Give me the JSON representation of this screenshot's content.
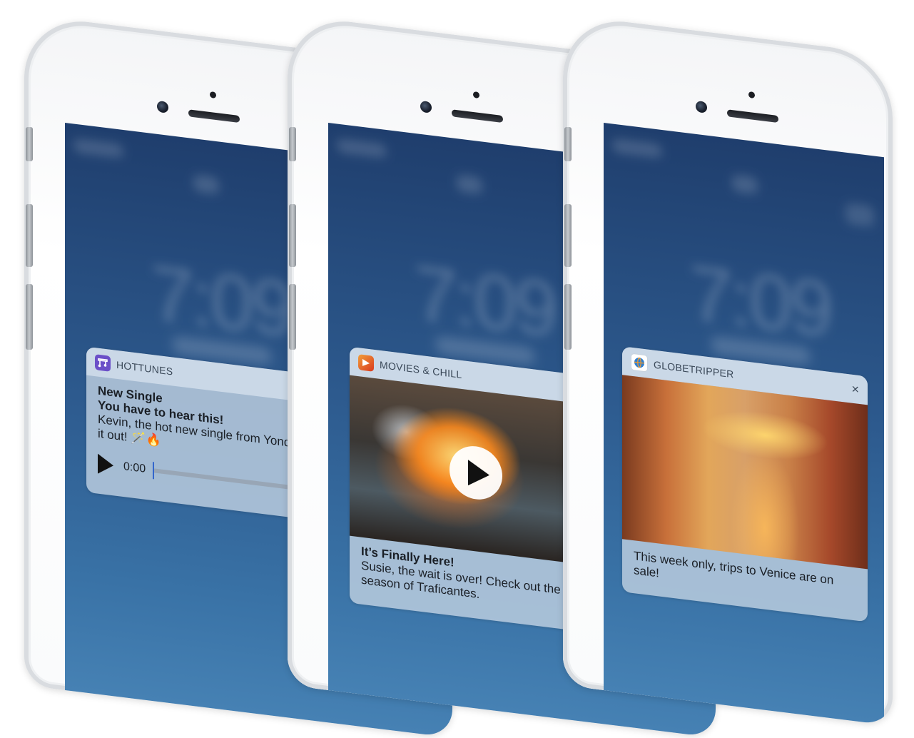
{
  "phones": [
    {
      "notification": {
        "app_name": "HOTTUNES",
        "icon": "music-note-icon",
        "icon_color": "#6b4fc8",
        "title": "New Single",
        "subtitle": "You have to hear this!",
        "message": "Kevin, the hot new single from YonderYo dropped. Check it out! 🪄🔥",
        "audio": {
          "time": "0:00",
          "progress": 0.0
        }
      }
    },
    {
      "notification": {
        "app_name": "MOVIES & CHILL",
        "icon": "movie-icon",
        "icon_color": "#e8651a",
        "title": "It’s Finally Here!",
        "message": "Susie, the wait is over! Check out the trailer the new season of Traficantes."
      }
    },
    {
      "notification": {
        "app_name": "GLOBETRIPPER",
        "icon": "globe-icon",
        "icon_color": "#2f7fd0",
        "close": "×",
        "message": "This week only, trips to Venice are on sale!"
      }
    }
  ]
}
